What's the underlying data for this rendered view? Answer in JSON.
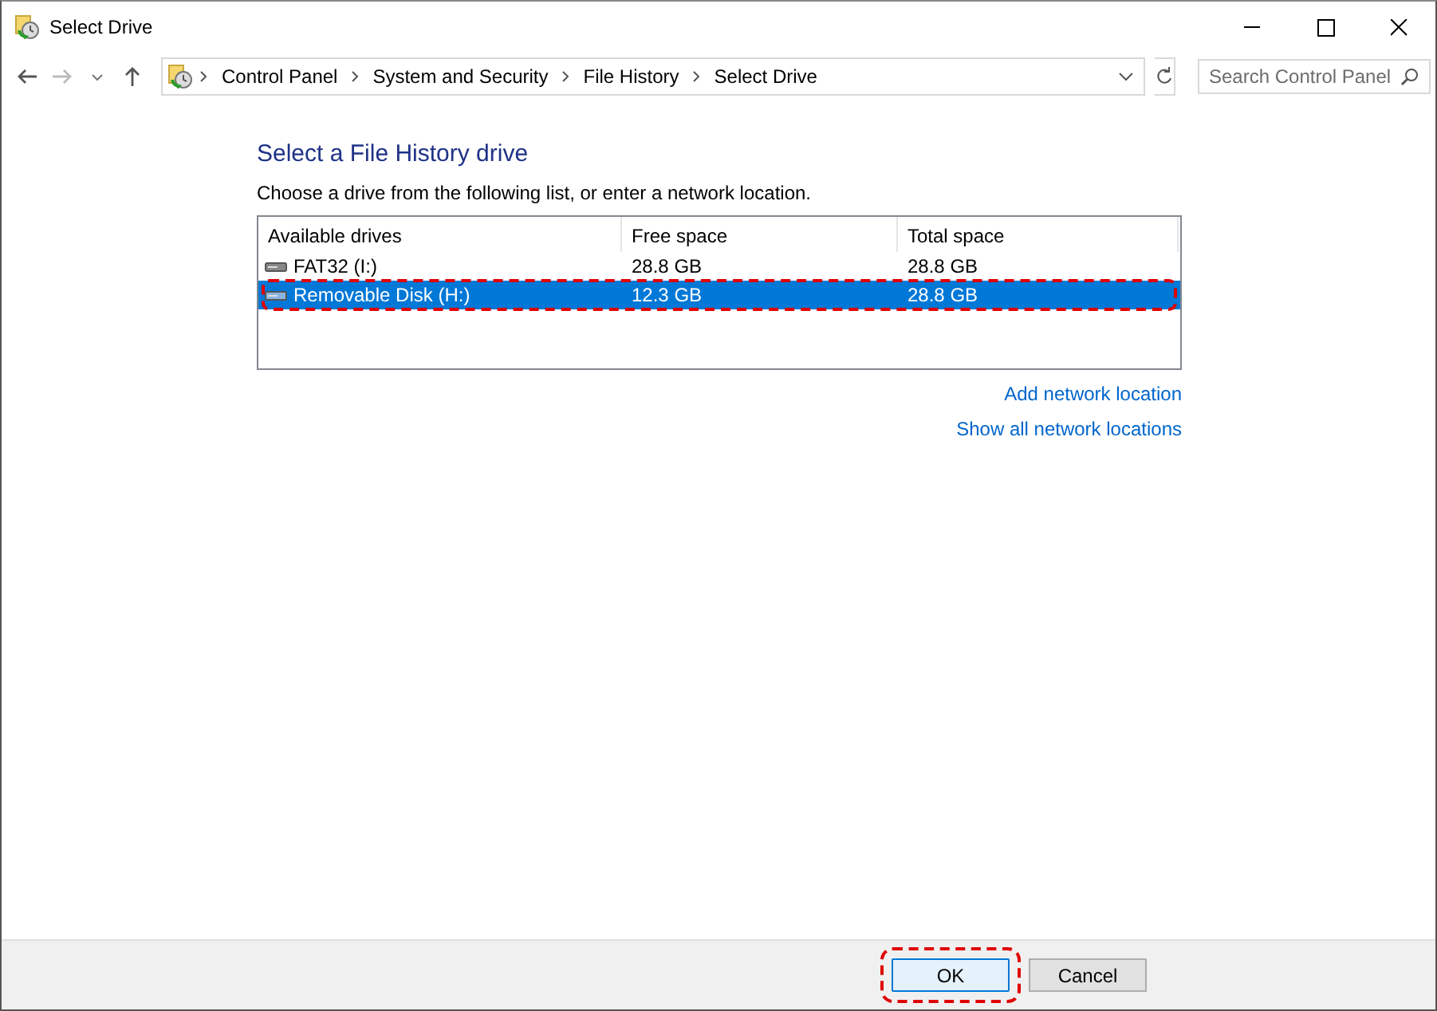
{
  "window": {
    "title": "Select Drive"
  },
  "address_bar": {
    "path": [
      {
        "label": "Control Panel"
      },
      {
        "label": "System and Security"
      },
      {
        "label": "File History"
      },
      {
        "label": "Select Drive"
      }
    ]
  },
  "search": {
    "placeholder": "Search Control Panel"
  },
  "heading": "Select a File History drive",
  "instruction": "Choose a drive from the following list, or enter a network location.",
  "table": {
    "columns": [
      "Available drives",
      "Free space",
      "Total space"
    ],
    "rows": [
      {
        "cells": [
          "FAT32 (I:)",
          "28.8 GB",
          "28.8 GB"
        ],
        "selected": false,
        "highlighted": false
      },
      {
        "cells": [
          "Removable Disk (H:)",
          "12.3 GB",
          "28.8 GB"
        ],
        "selected": true,
        "highlighted": true
      }
    ]
  },
  "links": [
    "Add network location",
    "Show all network locations"
  ],
  "buttons": [
    {
      "label": "OK",
      "kind": "default",
      "highlighted": true
    },
    {
      "label": "Cancel",
      "kind": "normal",
      "highlighted": false
    }
  ]
}
